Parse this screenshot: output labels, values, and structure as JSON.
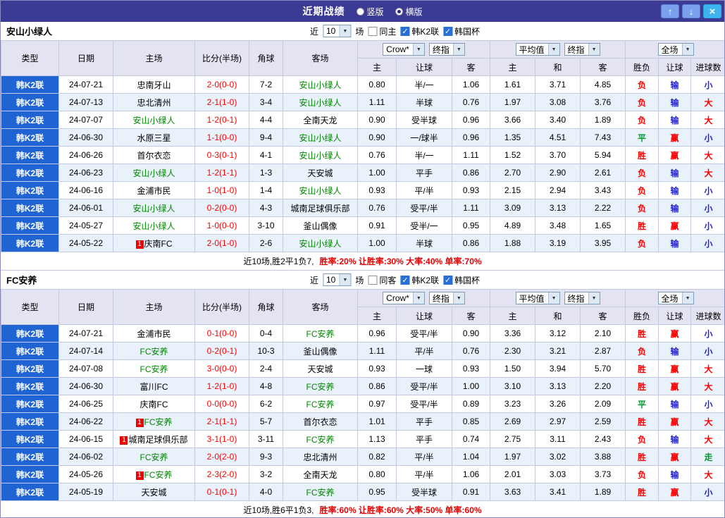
{
  "titlebar": {
    "title": "近期战绩",
    "vertical_label": "竖版",
    "horizontal_label": "横版",
    "vertical_selected": false,
    "horizontal_selected": true,
    "up_icon": "↑",
    "down_icon": "↓",
    "close_icon": "×"
  },
  "colors": {
    "css": {
      "titlebar-bg": "#3b3b95",
      "type-bg": "#2064d4",
      "row-alt": "#e9f1fb",
      "grid": "#c3c9e0",
      "header-bg": "#e3e3f2",
      "team-green": "#008800",
      "score-red": "#ff0000",
      "stat-red": "#e60000",
      "updown-btn": "#7aa0ee",
      "close-btn": "#3db3ef",
      "check-blue": "#2a6fd6",
      "badge-red": "#ee0000"
    },
    "result_map": {
      "胜": "#ff0000",
      "平": "#009933",
      "负": "#ff0000",
      "赢": "#ff0000",
      "输": "#2323cc",
      "大": "#ff0000",
      "小": "#2323cc",
      "走": "#009933"
    }
  },
  "sections": [
    {
      "team": "安山小绿人",
      "filter": {
        "near_label": "近",
        "count": "10",
        "games_label": "场",
        "same_label": "同主",
        "same_checked": false,
        "league_label": "韩K2联",
        "league_checked": true,
        "cup_label": "韩国杯",
        "cup_checked": true
      },
      "header": {
        "type": "类型",
        "date": "日期",
        "home": "主场",
        "score": "比分(半场)",
        "corner": "角球",
        "away": "客场",
        "bookmaker": "Crow*",
        "bookmaker_final": "终指",
        "average": "平均值",
        "average_final": "终指",
        "scope": "全场",
        "sub_home": "主",
        "sub_handicap": "让球",
        "sub_away": "客",
        "sub_avg_home": "主",
        "sub_avg_draw": "和",
        "sub_avg_away": "客",
        "sub_result": "胜负",
        "sub_handicap_result": "让球",
        "sub_goals": "进球数"
      },
      "rows": [
        {
          "league": "韩K2联",
          "date": "24-07-21",
          "home": "忠南牙山",
          "score": "2-0(0-0)",
          "corners": "7-2",
          "away": "安山小绿人",
          "away_hl": true,
          "h_odds": "0.80",
          "handicap": "半/一",
          "a_odds": "1.06",
          "avg_h": "1.61",
          "avg_d": "3.71",
          "avg_a": "4.85",
          "result": "负",
          "h_result": "输",
          "g_result": "小"
        },
        {
          "league": "韩K2联",
          "date": "24-07-13",
          "home": "忠北清州",
          "score": "2-1(1-0)",
          "corners": "3-4",
          "away": "安山小绿人",
          "away_hl": true,
          "h_odds": "1.11",
          "handicap": "半球",
          "a_odds": "0.76",
          "avg_h": "1.97",
          "avg_d": "3.08",
          "avg_a": "3.76",
          "result": "负",
          "h_result": "输",
          "g_result": "大"
        },
        {
          "league": "韩K2联",
          "date": "24-07-07",
          "home": "安山小绿人",
          "home_hl": true,
          "score": "1-2(0-1)",
          "corners": "4-4",
          "away": "全南天龙",
          "h_odds": "0.90",
          "handicap": "受半球",
          "a_odds": "0.96",
          "avg_h": "3.66",
          "avg_d": "3.40",
          "avg_a": "1.89",
          "result": "负",
          "h_result": "输",
          "g_result": "大"
        },
        {
          "league": "韩K2联",
          "date": "24-06-30",
          "home": "水原三星",
          "score": "1-1(0-0)",
          "corners": "9-4",
          "away": "安山小绿人",
          "away_hl": true,
          "h_odds": "0.90",
          "handicap": "一/球半",
          "a_odds": "0.96",
          "avg_h": "1.35",
          "avg_d": "4.51",
          "avg_a": "7.43",
          "result": "平",
          "h_result": "赢",
          "g_result": "小"
        },
        {
          "league": "韩K2联",
          "date": "24-06-26",
          "home": "首尔衣恋",
          "score": "0-3(0-1)",
          "corners": "4-1",
          "away": "安山小绿人",
          "away_hl": true,
          "h_odds": "0.76",
          "handicap": "半/一",
          "a_odds": "1.11",
          "avg_h": "1.52",
          "avg_d": "3.70",
          "avg_a": "5.94",
          "result": "胜",
          "h_result": "赢",
          "g_result": "大"
        },
        {
          "league": "韩K2联",
          "date": "24-06-23",
          "home": "安山小绿人",
          "home_hl": true,
          "score": "1-2(1-1)",
          "corners": "1-3",
          "away": "天安城",
          "h_odds": "1.00",
          "handicap": "平手",
          "a_odds": "0.86",
          "avg_h": "2.70",
          "avg_d": "2.90",
          "avg_a": "2.61",
          "result": "负",
          "h_result": "输",
          "g_result": "大"
        },
        {
          "league": "韩K2联",
          "date": "24-06-16",
          "home": "金浦市民",
          "score": "1-0(1-0)",
          "corners": "1-4",
          "away": "安山小绿人",
          "away_hl": true,
          "h_odds": "0.93",
          "handicap": "平/半",
          "a_odds": "0.93",
          "avg_h": "2.15",
          "avg_d": "2.94",
          "avg_a": "3.43",
          "result": "负",
          "h_result": "输",
          "g_result": "小"
        },
        {
          "league": "韩K2联",
          "date": "24-06-01",
          "home": "安山小绿人",
          "home_hl": true,
          "score": "0-2(0-0)",
          "corners": "4-3",
          "away": "城南足球俱乐部",
          "h_odds": "0.76",
          "handicap": "受平/半",
          "a_odds": "1.11",
          "avg_h": "3.09",
          "avg_d": "3.13",
          "avg_a": "2.22",
          "result": "负",
          "h_result": "输",
          "g_result": "小"
        },
        {
          "league": "韩K2联",
          "date": "24-05-27",
          "home": "安山小绿人",
          "home_hl": true,
          "score": "1-0(0-0)",
          "corners": "3-10",
          "away": "釜山偶像",
          "h_odds": "0.91",
          "handicap": "受半/一",
          "a_odds": "0.95",
          "avg_h": "4.89",
          "avg_d": "3.48",
          "avg_a": "1.65",
          "result": "胜",
          "h_result": "赢",
          "g_result": "小"
        },
        {
          "league": "韩K2联",
          "date": "24-05-22",
          "home": "庆南FC",
          "home_badge": "1",
          "score": "2-0(1-0)",
          "corners": "2-6",
          "away": "安山小绿人",
          "away_hl": true,
          "h_odds": "1.00",
          "handicap": "半球",
          "a_odds": "0.86",
          "avg_h": "1.88",
          "avg_d": "3.19",
          "avg_a": "3.95",
          "result": "负",
          "h_result": "输",
          "g_result": "小"
        }
      ],
      "summary": {
        "lead": "近10场,胜2平1负7,",
        "stats": [
          "胜率:20%",
          "让胜率:30%",
          "大率:40%",
          "单率:70%"
        ]
      }
    },
    {
      "team": "FC安养",
      "filter": {
        "near_label": "近",
        "count": "10",
        "games_label": "场",
        "same_label": "同客",
        "same_checked": false,
        "league_label": "韩K2联",
        "league_checked": true,
        "cup_label": "韩国杯",
        "cup_checked": true
      },
      "header": {
        "type": "类型",
        "date": "日期",
        "home": "主场",
        "score": "比分(半场)",
        "corner": "角球",
        "away": "客场",
        "bookmaker": "Crow*",
        "bookmaker_final": "终指",
        "average": "平均值",
        "average_final": "终指",
        "scope": "全场",
        "sub_home": "主",
        "sub_handicap": "让球",
        "sub_away": "客",
        "sub_avg_home": "主",
        "sub_avg_draw": "和",
        "sub_avg_away": "客",
        "sub_result": "胜负",
        "sub_handicap_result": "让球",
        "sub_goals": "进球数"
      },
      "rows": [
        {
          "league": "韩K2联",
          "date": "24-07-21",
          "home": "金浦市民",
          "score": "0-1(0-0)",
          "corners": "0-4",
          "away": "FC安养",
          "away_hl": true,
          "h_odds": "0.96",
          "handicap": "受平/半",
          "a_odds": "0.90",
          "avg_h": "3.36",
          "avg_d": "3.12",
          "avg_a": "2.10",
          "result": "胜",
          "h_result": "赢",
          "g_result": "小"
        },
        {
          "league": "韩K2联",
          "date": "24-07-14",
          "home": "FC安养",
          "home_hl": true,
          "score": "0-2(0-1)",
          "corners": "10-3",
          "away": "釜山偶像",
          "h_odds": "1.11",
          "handicap": "平/半",
          "a_odds": "0.76",
          "avg_h": "2.30",
          "avg_d": "3.21",
          "avg_a": "2.87",
          "result": "负",
          "h_result": "输",
          "g_result": "小"
        },
        {
          "league": "韩K2联",
          "date": "24-07-08",
          "home": "FC安养",
          "home_hl": true,
          "score": "3-0(0-0)",
          "corners": "2-4",
          "away": "天安城",
          "h_odds": "0.93",
          "handicap": "一球",
          "a_odds": "0.93",
          "avg_h": "1.50",
          "avg_d": "3.94",
          "avg_a": "5.70",
          "result": "胜",
          "h_result": "赢",
          "g_result": "大"
        },
        {
          "league": "韩K2联",
          "date": "24-06-30",
          "home": "富川FC",
          "score": "1-2(1-0)",
          "corners": "4-8",
          "away": "FC安养",
          "away_hl": true,
          "h_odds": "0.86",
          "handicap": "受平/半",
          "a_odds": "1.00",
          "avg_h": "3.10",
          "avg_d": "3.13",
          "avg_a": "2.20",
          "result": "胜",
          "h_result": "赢",
          "g_result": "大"
        },
        {
          "league": "韩K2联",
          "date": "24-06-25",
          "home": "庆南FC",
          "score": "0-0(0-0)",
          "corners": "6-2",
          "away": "FC安养",
          "away_hl": true,
          "h_odds": "0.97",
          "handicap": "受平/半",
          "a_odds": "0.89",
          "avg_h": "3.23",
          "avg_d": "3.26",
          "avg_a": "2.09",
          "result": "平",
          "h_result": "输",
          "g_result": "小"
        },
        {
          "league": "韩K2联",
          "date": "24-06-22",
          "home": "FC安养",
          "home_hl": true,
          "home_badge": "1",
          "score": "2-1(1-1)",
          "corners": "5-7",
          "away": "首尔衣恋",
          "h_odds": "1.01",
          "handicap": "平手",
          "a_odds": "0.85",
          "avg_h": "2.69",
          "avg_d": "2.97",
          "avg_a": "2.59",
          "result": "胜",
          "h_result": "赢",
          "g_result": "大"
        },
        {
          "league": "韩K2联",
          "date": "24-06-15",
          "home": "城南足球俱乐部",
          "home_badge": "1",
          "score": "3-1(1-0)",
          "corners": "3-11",
          "away": "FC安养",
          "away_hl": true,
          "h_odds": "1.13",
          "handicap": "平手",
          "a_odds": "0.74",
          "avg_h": "2.75",
          "avg_d": "3.11",
          "avg_a": "2.43",
          "result": "负",
          "h_result": "输",
          "g_result": "大"
        },
        {
          "league": "韩K2联",
          "date": "24-06-02",
          "home": "FC安养",
          "home_hl": true,
          "score": "2-0(2-0)",
          "corners": "9-3",
          "away": "忠北清州",
          "h_odds": "0.82",
          "handicap": "平/半",
          "a_odds": "1.04",
          "avg_h": "1.97",
          "avg_d": "3.02",
          "avg_a": "3.88",
          "result": "胜",
          "h_result": "赢",
          "g_result": "走"
        },
        {
          "league": "韩K2联",
          "date": "24-05-26",
          "home": "FC安养",
          "home_hl": true,
          "home_badge": "1",
          "score": "2-3(2-0)",
          "corners": "3-2",
          "away": "全南天龙",
          "h_odds": "0.80",
          "handicap": "平/半",
          "a_odds": "1.06",
          "avg_h": "2.01",
          "avg_d": "3.03",
          "avg_a": "3.73",
          "result": "负",
          "h_result": "输",
          "g_result": "大"
        },
        {
          "league": "韩K2联",
          "date": "24-05-19",
          "home": "天安城",
          "score": "0-1(0-1)",
          "corners": "4-0",
          "away": "FC安养",
          "away_hl": true,
          "h_odds": "0.95",
          "handicap": "受半球",
          "a_odds": "0.91",
          "avg_h": "3.63",
          "avg_d": "3.41",
          "avg_a": "1.89",
          "result": "胜",
          "h_result": "赢",
          "g_result": "小"
        }
      ],
      "summary": {
        "lead": "近10场,胜6平1负3,",
        "stats": [
          "胜率:60%",
          "让胜率:60%",
          "大率:50%",
          "单率:60%"
        ]
      }
    }
  ]
}
